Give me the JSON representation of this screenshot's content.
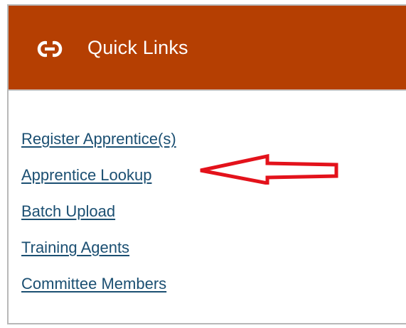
{
  "quick_links": {
    "title": "Quick Links",
    "header_icon": "link-icon",
    "header_color": "#b53f02",
    "link_color": "#1b4f72",
    "items": [
      {
        "label": "Register Apprentice(s)"
      },
      {
        "label": "Apprentice Lookup"
      },
      {
        "label": "Batch Upload"
      },
      {
        "label": "Training Agents"
      },
      {
        "label": "Committee Members"
      }
    ]
  },
  "annotation": {
    "type": "arrow",
    "color": "#e3121b",
    "points_to": "Apprentice Lookup"
  }
}
